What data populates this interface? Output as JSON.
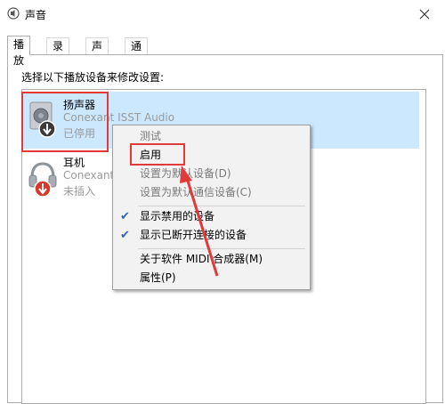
{
  "window": {
    "title": "声音"
  },
  "tabs": [
    {
      "label": "播放"
    },
    {
      "label": "录制"
    },
    {
      "label": "声音"
    },
    {
      "label": "通信"
    }
  ],
  "instruction": "选择以下播放设备来修改设置:",
  "devices": [
    {
      "name": "扬声器",
      "description": "Conexant ISST Audio",
      "status": "已停用",
      "icon": "speaker-icon"
    },
    {
      "name": "耳机",
      "description": "Conexant",
      "status": "未插入",
      "icon": "headphones-icon"
    }
  ],
  "context_menu": {
    "items": [
      {
        "label": "测试",
        "enabled": false,
        "checked": false
      },
      {
        "label": "启用",
        "enabled": true,
        "checked": false
      },
      {
        "label": "设置为默认设备(D)",
        "enabled": false,
        "checked": false
      },
      {
        "label": "设置为默认通信设备(C)",
        "enabled": false,
        "checked": false
      },
      {
        "label": "显示禁用的设备",
        "enabled": true,
        "checked": true
      },
      {
        "label": "显示已断开连接的设备",
        "enabled": true,
        "checked": true
      },
      {
        "label": "关于软件 MIDI 合成器(M)",
        "enabled": true,
        "checked": false
      },
      {
        "label": "属性(P)",
        "enabled": true,
        "checked": false
      }
    ]
  },
  "colors": {
    "selection": "#cce8ff",
    "annotation": "#e03a3a",
    "disabled_badge": "#3a3a3a",
    "unplugged_badge": "#d33a2c"
  }
}
